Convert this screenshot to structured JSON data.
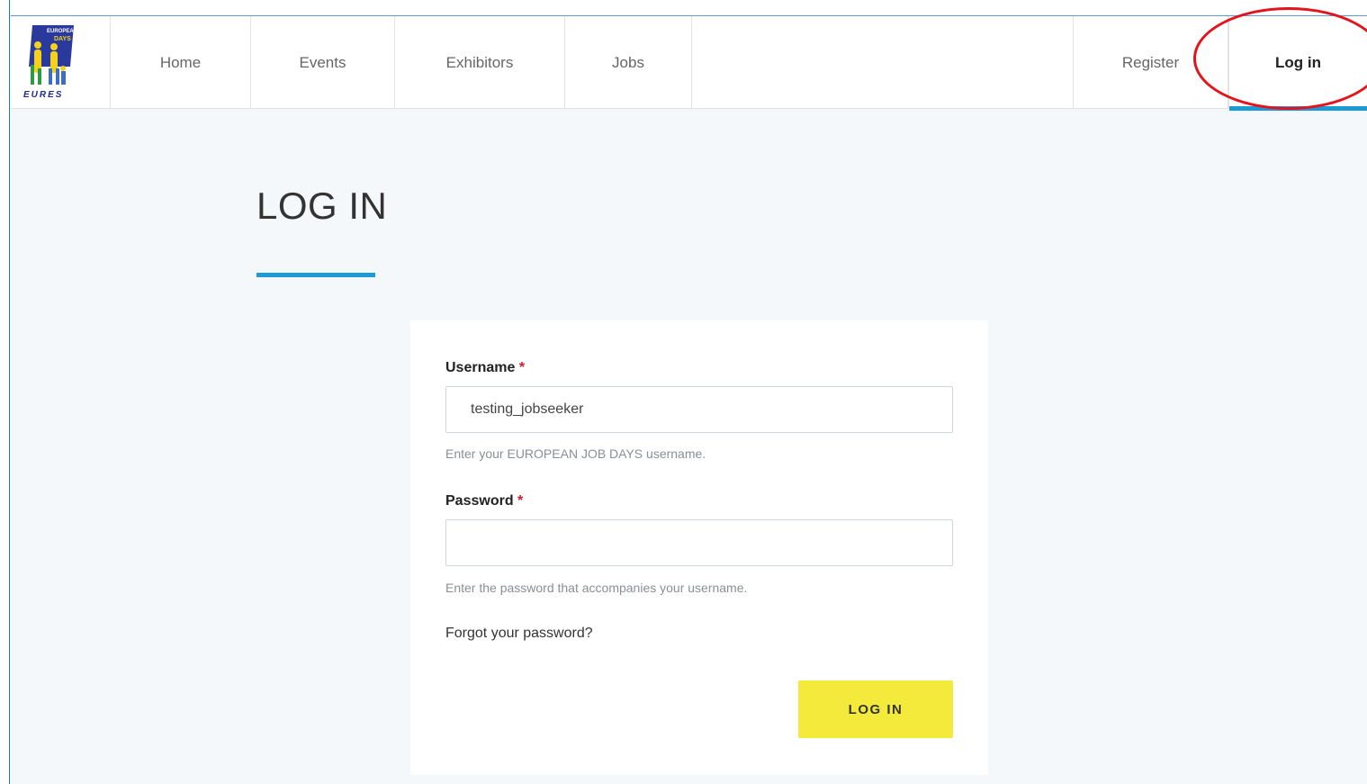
{
  "logo": {
    "top_text": "EUROPEAN JOB DAYS",
    "bottom_text": "EURES",
    "colors": {
      "bg": "#2a3a9c",
      "figure": "#f4d21c",
      "bottom_text": "#1c2a8c"
    }
  },
  "nav": {
    "items": [
      {
        "label": "Home"
      },
      {
        "label": "Events"
      },
      {
        "label": "Exhibitors"
      },
      {
        "label": "Jobs"
      }
    ],
    "register": "Register",
    "login": "Log in"
  },
  "page": {
    "title": "LOG IN"
  },
  "form": {
    "username_label": "Username",
    "username_required": "*",
    "username_value": "testing_jobseeker",
    "username_help": "Enter your EUROPEAN JOB DAYS username.",
    "password_label": "Password",
    "password_required": "*",
    "password_value": "",
    "password_help": "Enter the password that accompanies your username.",
    "forgot_link": "Forgot your password?",
    "submit_label": "LOG IN"
  },
  "colors": {
    "accent": "#1c9ad6",
    "button": "#f4ea3b",
    "required": "#d6182b",
    "annotation": "#e3141b"
  }
}
